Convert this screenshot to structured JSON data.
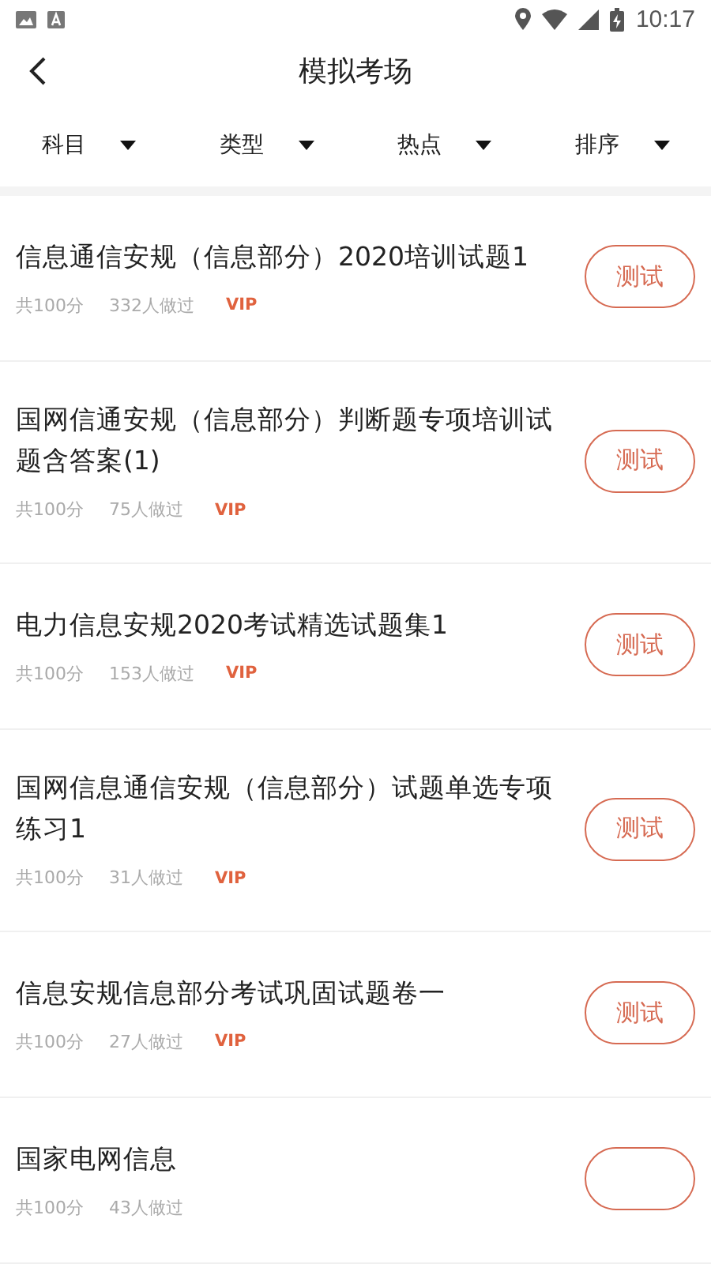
{
  "status_bar": {
    "time": "10:17"
  },
  "header": {
    "title": "模拟考场"
  },
  "filters": [
    {
      "label": "科目"
    },
    {
      "label": "类型"
    },
    {
      "label": "热点"
    },
    {
      "label": "排序"
    }
  ],
  "exams": [
    {
      "title": "信息通信安规（信息部分）2020培训试题1",
      "score": "共100分",
      "takers": "332人做过",
      "vip": true,
      "vip_label": "VIP",
      "action": "测试"
    },
    {
      "title": "国网信通安规（信息部分）判断题专项培训试题含答案(1)",
      "score": "共100分",
      "takers": "75人做过",
      "vip": true,
      "vip_label": "VIP",
      "action": "测试"
    },
    {
      "title": "电力信息安规2020考试精选试题集1",
      "score": "共100分",
      "takers": "153人做过",
      "vip": true,
      "vip_label": "VIP",
      "action": "测试"
    },
    {
      "title": "国网信息通信安规（信息部分）试题单选专项练习1",
      "score": "共100分",
      "takers": "31人做过",
      "vip": true,
      "vip_label": "VIP",
      "action": "测试"
    },
    {
      "title": "信息安规信息部分考试巩固试题卷一",
      "score": "共100分",
      "takers": "27人做过",
      "vip": true,
      "vip_label": "VIP",
      "action": "测试"
    },
    {
      "title": "国家电网信息",
      "score": "共100分",
      "takers": "43人做过",
      "vip": false
    }
  ]
}
